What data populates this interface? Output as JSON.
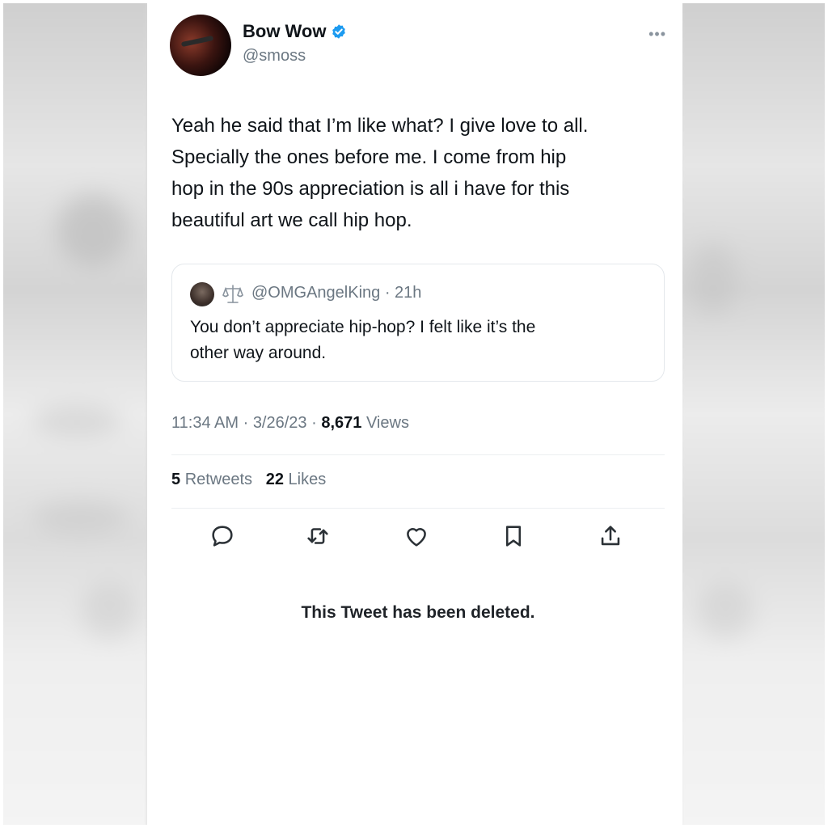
{
  "tweet": {
    "display_name": "Bow Wow",
    "handle": "@smoss",
    "more_icon": "more-horizontal-icon",
    "verified_icon": "verified-badge-icon",
    "text": "Yeah he said that I’m like what? I give love to all.\nSpecially the ones before me. I come from hip\nhop in the 90s appreciation is all i have for this\nbeautiful art we call hip hop.",
    "time": "11:34 AM",
    "date": "3/26/23",
    "views_count": "8,671",
    "views_label": "Views",
    "retweets_count": "5",
    "retweets_label": "Retweets",
    "likes_count": "22",
    "likes_label": "Likes"
  },
  "quoted": {
    "handle_and_time": "@OMGAngelKing · 21h",
    "text": "You don’t appreciate hip-hop? I felt like it’s the\nother way around.",
    "badge_icon": "scales-icon"
  },
  "actions": [
    "reply-icon",
    "retweet-icon",
    "like-icon",
    "bookmark-icon",
    "share-icon"
  ],
  "footer": {
    "deleted_notice": "This Tweet has been deleted."
  },
  "colors": {
    "text_primary": "#0f1419",
    "text_secondary": "#6b7782",
    "verified": "#1d9bf0",
    "border": "#e4e8ec"
  }
}
